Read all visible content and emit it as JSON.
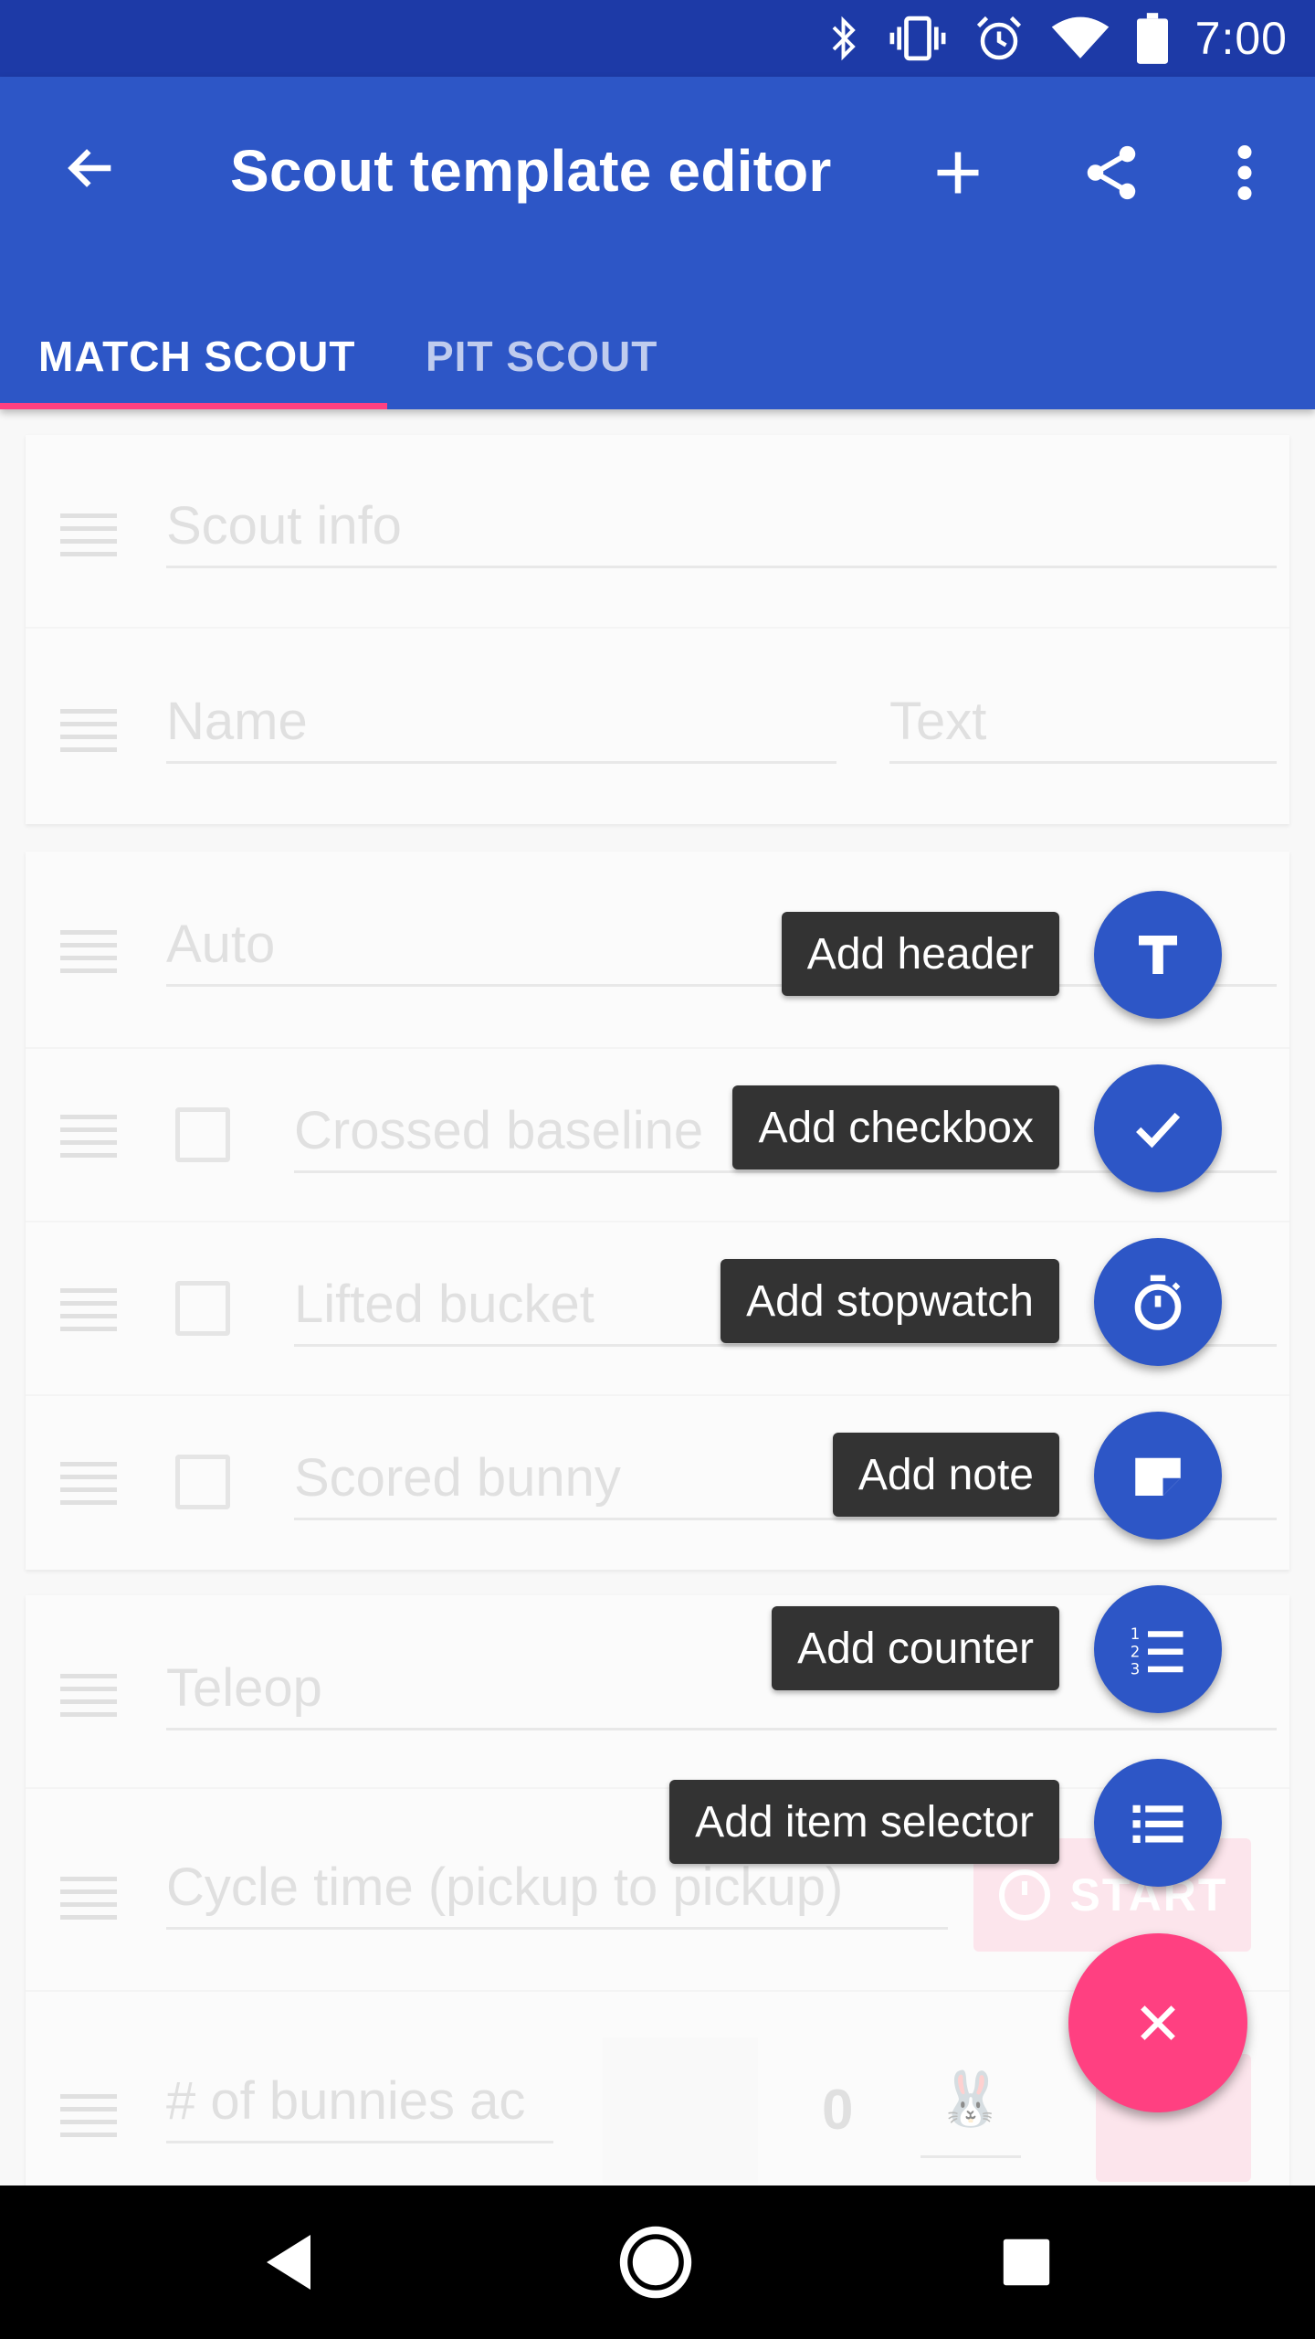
{
  "status_bar": {
    "time": "7:00",
    "icons": [
      "bluetooth-icon",
      "vibrate-icon",
      "alarm-icon",
      "wifi-icon",
      "battery-icon"
    ]
  },
  "app_bar": {
    "title": "Scout template editor",
    "actions": [
      "back-arrow-icon",
      "add-icon",
      "share-icon",
      "more-vert-icon"
    ]
  },
  "tabs": [
    {
      "label": "MATCH SCOUT",
      "active": true
    },
    {
      "label": "PIT SCOUT",
      "active": false
    }
  ],
  "cards": {
    "scout_info": {
      "header": "Scout info",
      "name_placeholder": "Name",
      "type_placeholder": "Text"
    },
    "auto": {
      "header": "Auto",
      "items": [
        "Crossed baseline",
        "Lifted bucket",
        "Scored bunny"
      ]
    },
    "teleop": {
      "header": "Teleop",
      "stopwatch_label": "Cycle time (pickup to pickup)",
      "start_label": "START",
      "counter_label": "# of bunnies ac",
      "counter_value": "0"
    }
  },
  "speed_dial": [
    {
      "label": "Add header",
      "icon": "header-t-icon"
    },
    {
      "label": "Add checkbox",
      "icon": "check-icon"
    },
    {
      "label": "Add stopwatch",
      "icon": "stopwatch-icon"
    },
    {
      "label": "Add note",
      "icon": "note-icon"
    },
    {
      "label": "Add counter",
      "icon": "counter-list-icon"
    },
    {
      "label": "Add item selector",
      "icon": "list-icon"
    }
  ],
  "colors": {
    "primary": "#2d56c6",
    "primary_dark": "#1d3aa7",
    "accent": "#ff4081"
  }
}
